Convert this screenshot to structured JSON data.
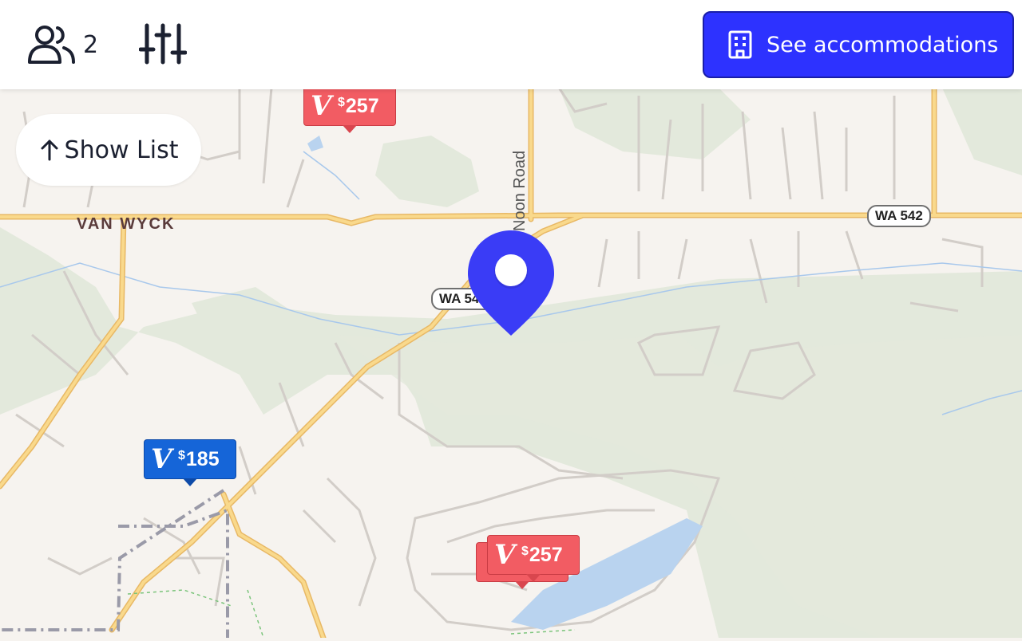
{
  "header": {
    "guest_count": "2",
    "cta_label": "See accommodations",
    "guests_icon": "users-icon",
    "filters_icon": "sliders-icon",
    "cta_icon": "building-icon"
  },
  "list_toggle": {
    "label": "Show List",
    "icon": "arrow-up-icon"
  },
  "map": {
    "place_label": "VAN WYCK",
    "road_label": "Noon Road",
    "shields": [
      "WA 542",
      "WA 542"
    ],
    "markers": [
      {
        "currency": "$",
        "price": "257",
        "status": "default",
        "color": "#f25c63"
      },
      {
        "currency": "$",
        "price": "185",
        "status": "selected",
        "color": "#1565d8"
      },
      {
        "currency": "$",
        "price": "257",
        "status": "default",
        "color": "#f25c63"
      }
    ],
    "location_pin_color": "#3a3cf6",
    "colors": {
      "land": "#f6f3ef",
      "forest": "#e3e9dc",
      "highway": "#f9d98c",
      "road": "#d2cdc8",
      "water": "#b9d3ef"
    }
  },
  "accent": "#2d32ff"
}
